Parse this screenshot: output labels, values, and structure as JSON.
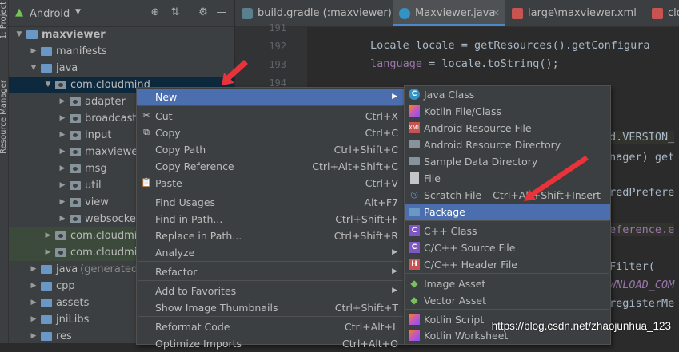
{
  "left_strip": {
    "tab1": "1: Project",
    "tab2": "Resource Manager"
  },
  "project_panel": {
    "view_selector": "Android",
    "tree": [
      {
        "label": "maxviewer",
        "bold": true
      },
      {
        "label": "manifests"
      },
      {
        "label": "java"
      },
      {
        "label": "com.cloudmind"
      },
      {
        "label": "adapter"
      },
      {
        "label": "broadcast"
      },
      {
        "label": "input"
      },
      {
        "label": "maxviewer"
      },
      {
        "label": "msg"
      },
      {
        "label": "util"
      },
      {
        "label": "view"
      },
      {
        "label": "websocket"
      },
      {
        "label": "com.cloudmind"
      },
      {
        "label": "com.cloudmind"
      },
      {
        "label": "java",
        "suffix": "(generated)"
      },
      {
        "label": "cpp"
      },
      {
        "label": "assets"
      },
      {
        "label": "jniLibs"
      },
      {
        "label": "res"
      }
    ]
  },
  "editor": {
    "tabs": [
      {
        "label": "build.gradle (:maxviewer)"
      },
      {
        "label": "Maxviewer.java"
      },
      {
        "label": "large\\maxviewer.xml"
      },
      {
        "label": "clda"
      }
    ],
    "line_numbers": [
      "191",
      "192",
      "193",
      "194"
    ],
    "code": {
      "line1": "Locale locale = getResources().getConfigura",
      "line2a": "language",
      "line2b": " = locale.toString();",
      "frag1": "d.VERSION_",
      "frag2": "nager) get",
      "frag3": "redPrefere",
      "frag4": "eference.e",
      "frag5": "Filter(",
      "frag6": "WNLOAD_COM",
      "frag7": "registerMe"
    }
  },
  "context_menu": {
    "items": [
      {
        "label": "New",
        "submenu": true
      },
      {
        "label": "Cut",
        "shortcut": "Ctrl+X",
        "icon": "cut-icon"
      },
      {
        "label": "Copy",
        "shortcut": "Ctrl+C",
        "icon": "copy-icon"
      },
      {
        "label": "Copy Path",
        "shortcut": "Ctrl+Shift+C"
      },
      {
        "label": "Copy Reference",
        "shortcut": "Ctrl+Alt+Shift+C"
      },
      {
        "label": "Paste",
        "shortcut": "Ctrl+V",
        "icon": "paste-icon"
      },
      {
        "label": "Find Usages",
        "shortcut": "Alt+F7"
      },
      {
        "label": "Find in Path...",
        "shortcut": "Ctrl+Shift+F"
      },
      {
        "label": "Replace in Path...",
        "shortcut": "Ctrl+Shift+R"
      },
      {
        "label": "Analyze",
        "submenu": true
      },
      {
        "label": "Refactor",
        "submenu": true
      },
      {
        "label": "Add to Favorites",
        "submenu": true
      },
      {
        "label": "Show Image Thumbnails",
        "shortcut": "Ctrl+Shift+T"
      },
      {
        "label": "Reformat Code",
        "shortcut": "Ctrl+Alt+L"
      },
      {
        "label": "Optimize Imports",
        "shortcut": "Ctrl+Alt+O"
      }
    ]
  },
  "new_submenu": {
    "items": [
      {
        "label": "Java Class"
      },
      {
        "label": "Kotlin File/Class"
      },
      {
        "label": "Android Resource File"
      },
      {
        "label": "Android Resource Directory"
      },
      {
        "label": "Sample Data Directory"
      },
      {
        "label": "File"
      },
      {
        "label": "Scratch File",
        "shortcut": "Ctrl+Alt+Shift+Insert"
      },
      {
        "label": "Package"
      },
      {
        "label": "C++ Class"
      },
      {
        "label": "C/C++ Source File"
      },
      {
        "label": "C/C++ Header File"
      },
      {
        "label": "Image Asset"
      },
      {
        "label": "Vector Asset"
      },
      {
        "label": "Kotlin Script"
      },
      {
        "label": "Kotlin Worksheet"
      }
    ]
  },
  "watermark": "https://blog.csdn.net/zhaojunhua_123",
  "colors": {
    "selection": "#4b6eaf",
    "arrow": "#e8333a",
    "panel": "#3c3f41",
    "editor": "#2b2b2b"
  }
}
